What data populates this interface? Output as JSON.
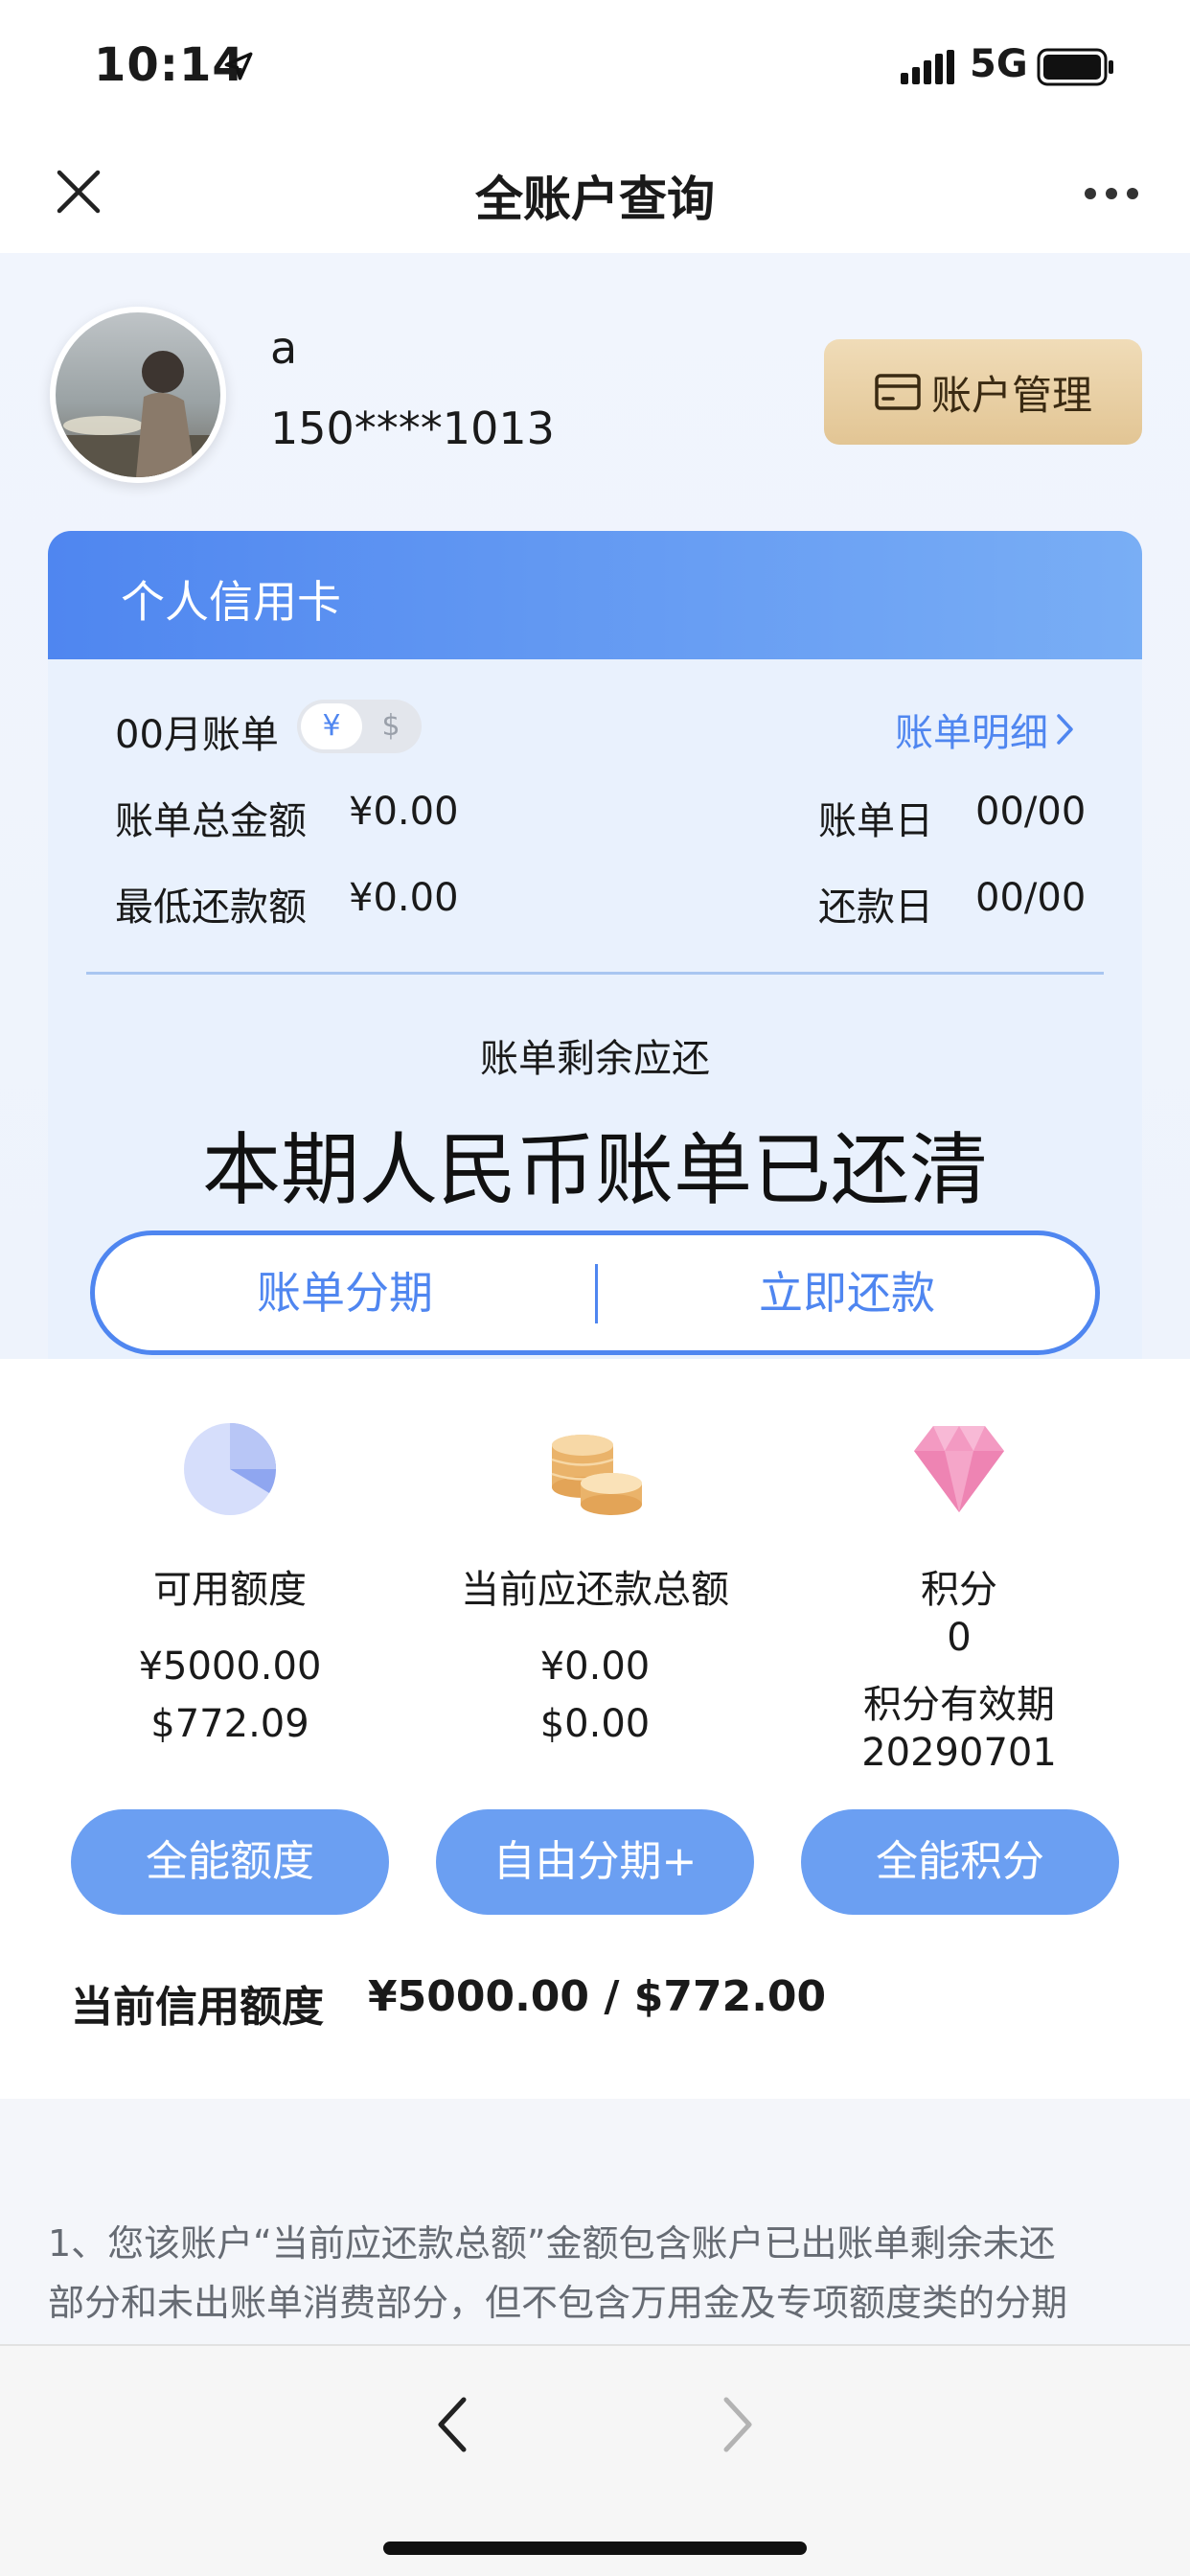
{
  "status_bar": {
    "time": "10:14",
    "network": "5G"
  },
  "nav": {
    "title": "全账户查询"
  },
  "user": {
    "name": "a",
    "phone": "150****1013",
    "account_button": "账户管理"
  },
  "card": {
    "title": "个人信用卡",
    "bill_month": "00月账单",
    "currency_rmb": "¥",
    "currency_usd": "$",
    "bill_detail": "账单明细",
    "total_label": "账单总金额",
    "total_value": "¥0.00",
    "min_label": "最低还款额",
    "min_value": "¥0.00",
    "bill_day_label": "账单日",
    "bill_day_value": "00/00",
    "repay_day_label": "还款日",
    "repay_day_value": "00/00",
    "remaining_label": "账单剩余应还",
    "status_text": "本期人民币账单已还清",
    "installment_button": "账单分期",
    "repay_button": "立即还款"
  },
  "stats": {
    "available": {
      "label": "可用额度",
      "rmb": "¥5000.00",
      "usd": "$772.09",
      "button": "全能额度"
    },
    "current_due": {
      "label": "当前应还款总额",
      "rmb": "¥0.00",
      "usd": "$0.00",
      "button": "自由分期+"
    },
    "points": {
      "label": "积分",
      "value": "0",
      "expiry_label": "积分有效期",
      "expiry_value": "20290701",
      "button": "全能积分"
    },
    "credit_limit_label": "当前信用额度",
    "credit_limit_value": "¥5000.00 / $772.00"
  },
  "notes": {
    "line1": "1、您该账户“当前应还款总额”金额包含账户已出账单剩余未还",
    "line2": "部分和未出账单消费部分，但不包含万用金及专项额度类的分期"
  },
  "colors": {
    "accent": "#4f86f0",
    "button_blue": "#6b9ff2",
    "gold": "#e2c594"
  }
}
